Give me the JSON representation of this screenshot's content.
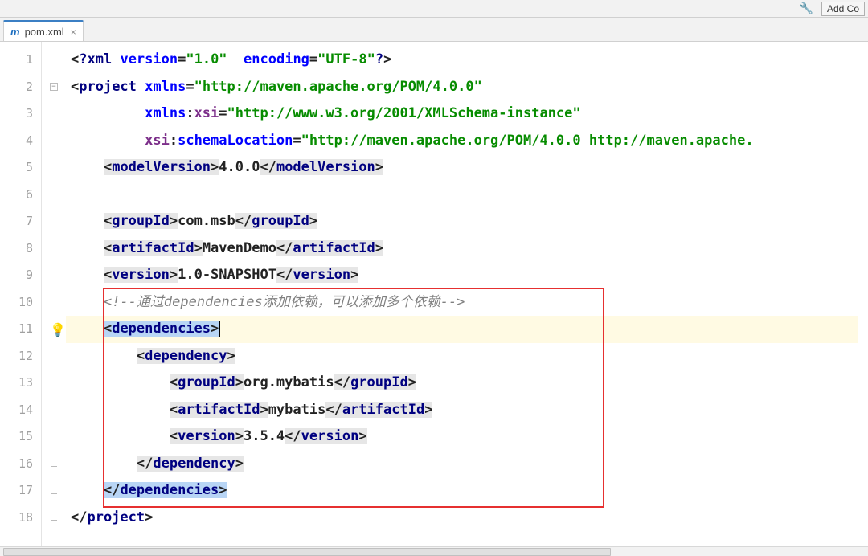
{
  "toolbar": {
    "add_button": "Add Co"
  },
  "tab": {
    "filename": "pom.xml"
  },
  "gutter": {
    "lines": [
      "1",
      "2",
      "3",
      "4",
      "5",
      "6",
      "7",
      "8",
      "9",
      "10",
      "11",
      "12",
      "13",
      "14",
      "15",
      "16",
      "17",
      "18"
    ]
  },
  "chart_data": {
    "type": "table",
    "title": "pom.xml",
    "content": "<?xml version=\"1.0\" encoding=\"UTF-8\"?>\n<project xmlns=\"http://maven.apache.org/POM/4.0.0\"\n         xmlns:xsi=\"http://www.w3.org/2001/XMLSchema-instance\"\n         xsi:schemaLocation=\"http://maven.apache.org/POM/4.0.0 http://maven.apache.\n    <modelVersion>4.0.0</modelVersion>\n\n    <groupId>com.msb</groupId>\n    <artifactId>MavenDemo</artifactId>\n    <version>1.0-SNAPSHOT</version>\n    <!--通过dependencies添加依赖，可以添加多个依赖-->\n    <dependencies>\n        <dependency>\n            <groupId>org.mybatis</groupId>\n            <artifactId>mybatis</artifactId>\n            <version>3.5.4</version>\n        </dependency>\n    </dependencies>\n</project>"
  },
  "code": {
    "l1": {
      "xml": "?xml",
      "versionAttr": "version",
      "versionVal": "\"1.0\"",
      "encodingAttr": "encoding",
      "encodingVal": "\"UTF-8\"",
      "close": "?"
    },
    "l2": {
      "project": "project",
      "xmlns": "xmlns",
      "url": "\"http://maven.apache.org/POM/4.0.0\""
    },
    "l3": {
      "xmlns": "xmlns",
      "xsi": "xsi",
      "url": "\"http://www.w3.org/2001/XMLSchema-instance\""
    },
    "l4": {
      "xsi": "xsi",
      "schemaLocation": "schemaLocation",
      "url": "\"http://maven.apache.org/POM/4.0.0 http://maven.apache."
    },
    "l5": {
      "tag": "modelVersion",
      "val": "4.0.0"
    },
    "l7": {
      "tag": "groupId",
      "val": "com.msb"
    },
    "l8": {
      "tag": "artifactId",
      "val": "MavenDemo"
    },
    "l9": {
      "tag": "version",
      "val": "1.0-SNAPSHOT"
    },
    "l10": {
      "comment": "<!--通过dependencies添加依赖，可以添加多个依赖-->"
    },
    "l11": {
      "tag": "dependencies"
    },
    "l12": {
      "tag": "dependency"
    },
    "l13": {
      "tag": "groupId",
      "val": "org.mybatis"
    },
    "l14": {
      "tag": "artifactId",
      "val": "mybatis"
    },
    "l15": {
      "tag": "version",
      "val": "3.5.4"
    },
    "l16": {
      "tag": "dependency"
    },
    "l17": {
      "tag": "dependencies"
    },
    "l18": {
      "tag": "project"
    }
  }
}
